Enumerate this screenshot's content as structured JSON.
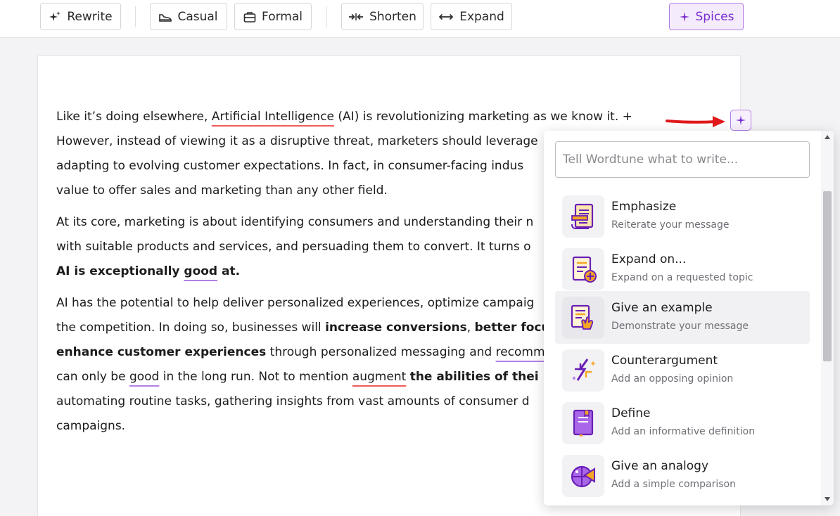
{
  "toolbar": {
    "rewrite": "Rewrite",
    "casual": "Casual",
    "formal": "Formal",
    "shorten": "Shorten",
    "expand": "Expand",
    "spices": "Spices"
  },
  "document": {
    "p1": {
      "l1a": "Like it’s doing elsewhere, ",
      "l1b": "Artificial Intelligence",
      "l1c": " (AI) is revolutionizing marketing as we know it. +",
      "l2": "However, instead of viewing it as a disruptive threat, marketers should leverage",
      "l3": "adapting to evolving customer expectations.   In fact, in consumer-facing indus",
      "l4": "value to offer sales and marketing than any other field."
    },
    "p2": {
      "l1": "At its core, marketing is about identifying consumers and understanding their n",
      "l2": "with suitable products and services, and persuading them to convert.  It turns o",
      "l3a": "AI is exceptionally ",
      "l3b": "good",
      "l3c": " at."
    },
    "p3": {
      "l1": "AI has the potential to help deliver personalized experiences, optimize campaig",
      "l2a": "the competition. In doing so, businesses will ",
      "l2b": "increase conversions",
      "l2c": ", ",
      "l2d": "better focu",
      "l3a": "enhance customer experiences",
      "l3b": " through personalized messaging and ",
      "l3c": "recomm",
      "l4a": "can only be ",
      "l4b": "good",
      "l4c": " in the long run. Not to mention ",
      "l4d": "augment",
      "l4e": " ",
      "l4f": "the abilities of thei",
      "l5": "automating routine tasks, gathering insights from vast amounts of consumer d",
      "l6": "campaigns."
    }
  },
  "popup": {
    "placeholder": "Tell Wordtune what to write...",
    "options": [
      {
        "title": "Emphasize",
        "subtitle": "Reiterate your message",
        "icon": "emphasize-icon"
      },
      {
        "title": "Expand on...",
        "subtitle": "Expand on a requested topic",
        "icon": "expand-on-icon"
      },
      {
        "title": "Give an example",
        "subtitle": "Demonstrate your message",
        "icon": "example-icon"
      },
      {
        "title": "Counterargument",
        "subtitle": "Add an opposing opinion",
        "icon": "counterargument-icon"
      },
      {
        "title": "Define",
        "subtitle": "Add an informative definition",
        "icon": "define-icon"
      },
      {
        "title": "Give an analogy",
        "subtitle": "Add a simple comparison",
        "icon": "analogy-icon"
      }
    ]
  },
  "colors": {
    "accent": "#7a2bd1",
    "accent_light": "#f4ecfc",
    "red_underline": "#ef5b5b",
    "purple_underline": "#b37ee6",
    "arrow": "#e0191b"
  }
}
